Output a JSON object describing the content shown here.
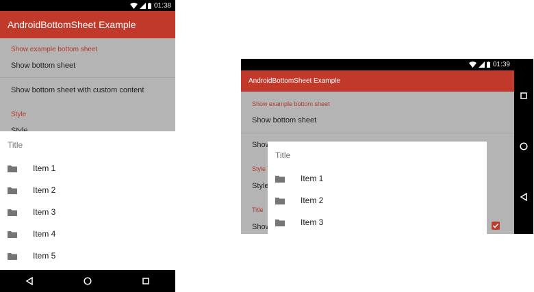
{
  "portrait": {
    "status_time": "01:38",
    "app_title": "AndroidBottomSheet Example",
    "section_show": "Show example bottom sheet",
    "row_show": "Show bottom sheet",
    "row_show_custom": "Show bottom sheet with custom content",
    "section_style": "Style",
    "row_style_partial": "Style",
    "sheet": {
      "title": "Title",
      "items": [
        "Item 1",
        "Item 2",
        "Item 3",
        "Item 4",
        "Item 5"
      ]
    }
  },
  "landscape": {
    "status_time": "01:39",
    "app_title": "AndroidBottomSheet Example",
    "section_show": "Show example bottom sheet",
    "row_show": "Show bottom sheet",
    "row_show_partial": "Show",
    "section_style": "Style",
    "row_style_partial": "Style",
    "section_title": "Title",
    "row_title_partial": "Show",
    "sheet": {
      "title": "Title",
      "items": [
        "Item 1",
        "Item 2",
        "Item 3"
      ]
    }
  },
  "colors": {
    "app_bar": "#c0392b",
    "accent": "#b03a2e",
    "scrim": "#b4b4b4"
  },
  "icons": {
    "item": "folder-icon",
    "nav_back": "back-triangle-icon",
    "nav_home": "home-circle-icon",
    "nav_recents": "recents-square-icon",
    "status": [
      "wifi-icon",
      "signal-icon",
      "battery-icon"
    ],
    "checkbox": "checkbox-checked-icon"
  }
}
